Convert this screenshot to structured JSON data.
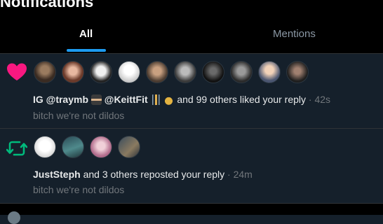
{
  "header": {
    "title": "Notifications",
    "tabs": [
      {
        "label": "All",
        "active": true
      },
      {
        "label": "Mentions",
        "active": false
      }
    ]
  },
  "notifications": [
    {
      "type": "like",
      "icon": "heart-icon",
      "actor1": "IG @traymb",
      "actor2": "@KeittFit",
      "action": "and 99 others liked your reply",
      "time": "· 42s",
      "snippet": "bitch we're not dildos"
    },
    {
      "type": "repost",
      "icon": "repost-icon",
      "actor1": "JustSteph",
      "action": "and 3 others reposted your reply",
      "time": "· 24m",
      "snippet": "bitch we're not dildos"
    }
  ],
  "colors": {
    "background": "#15202b",
    "header_bg": "#000000",
    "accent": "#1d9bf0",
    "like": "#f91880",
    "repost": "#00ba7c",
    "muted": "#71767b"
  }
}
